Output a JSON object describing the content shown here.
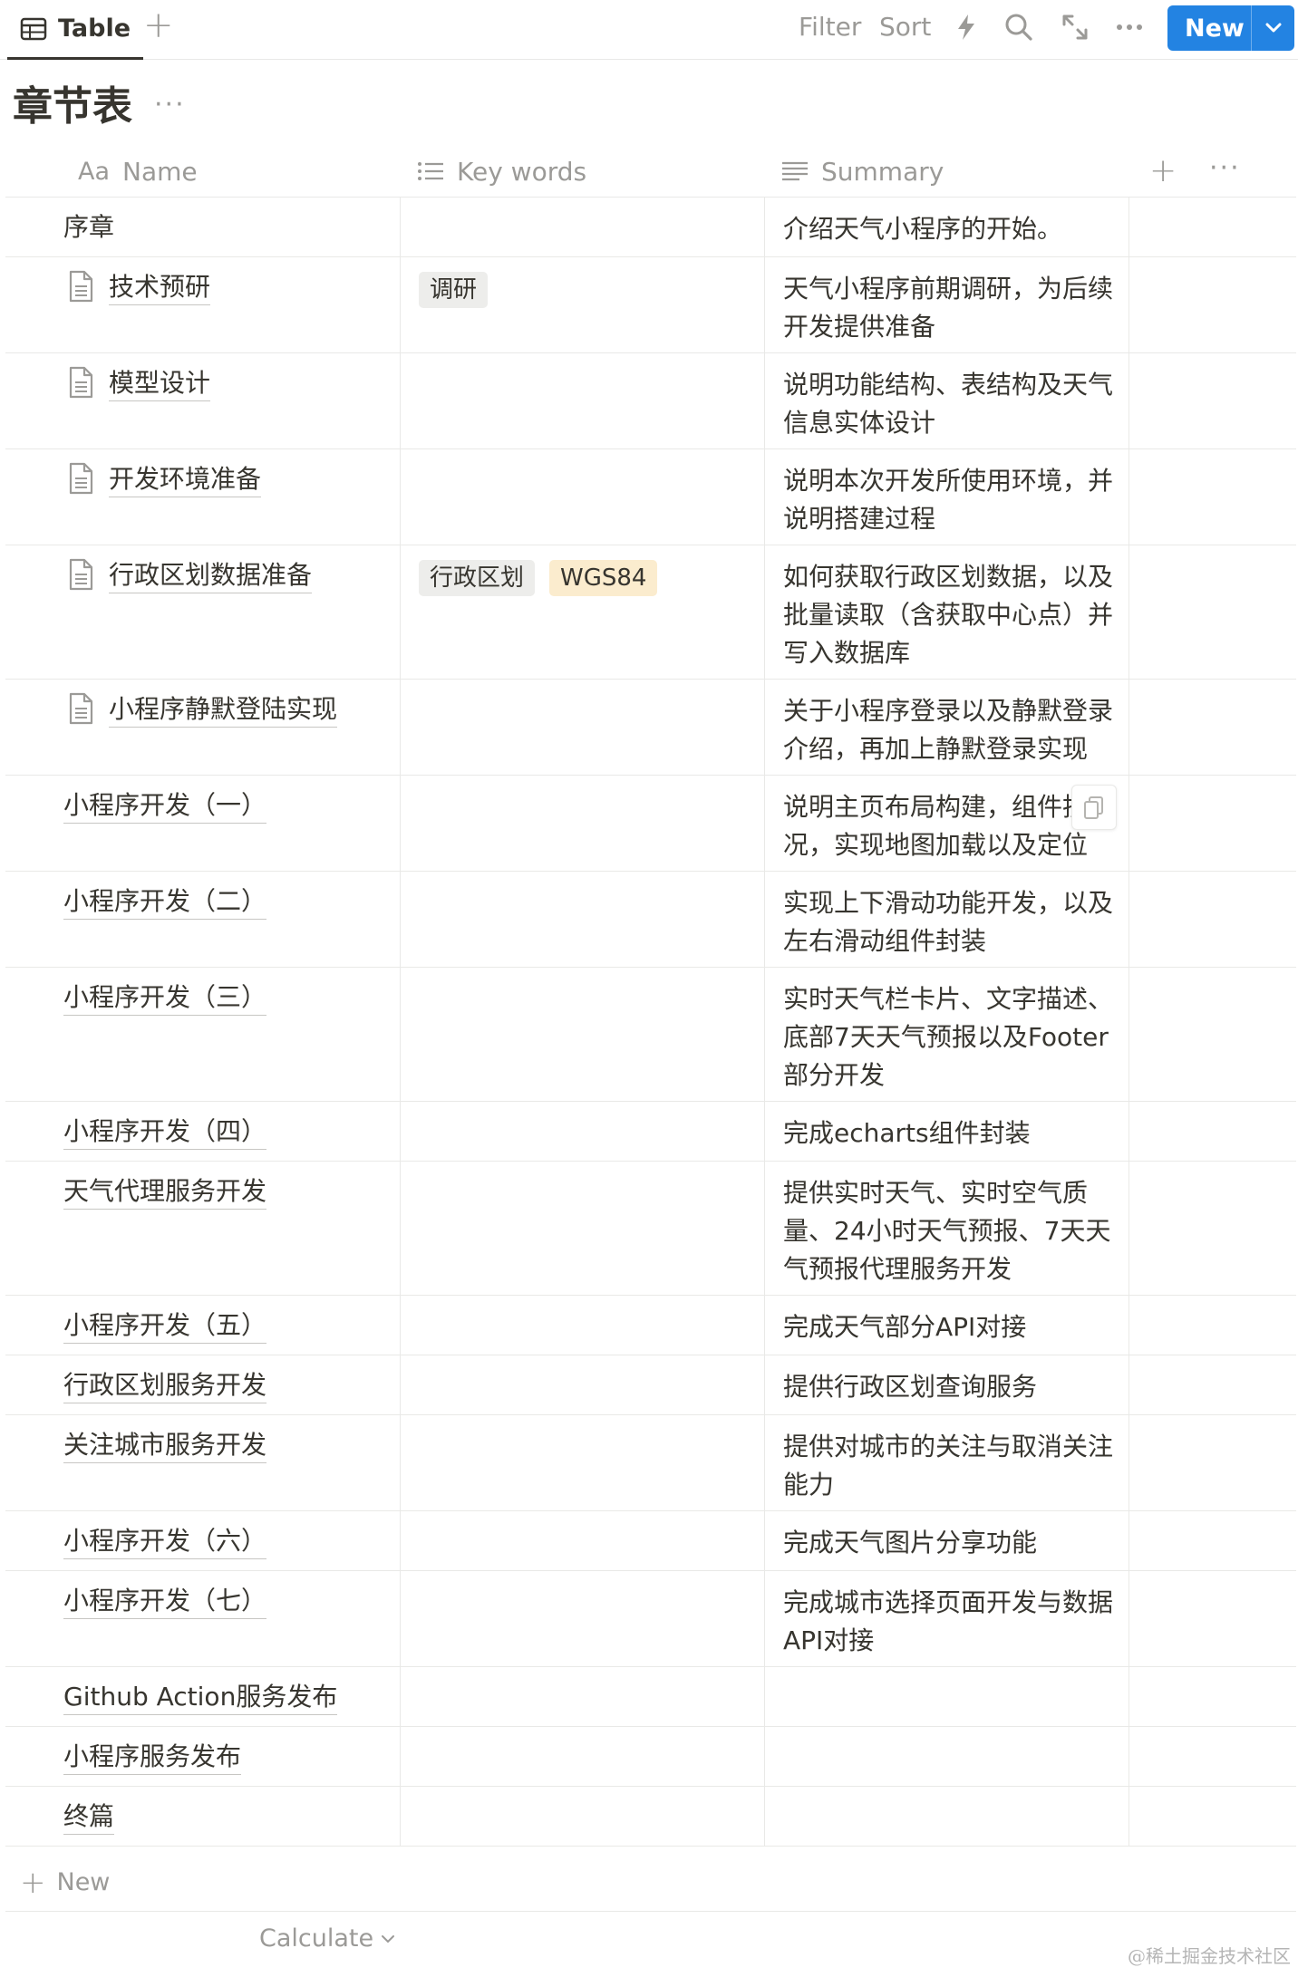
{
  "toolbar": {
    "view_tab": {
      "label": "Table",
      "icon": "table-icon"
    },
    "add_view_label": "+",
    "filter_label": "Filter",
    "sort_label": "Sort",
    "icons": [
      "lightning-icon",
      "search-icon",
      "expand-icon",
      "more-icon"
    ],
    "more_label": "···",
    "new_button_label": "New",
    "accent": "#2383e2"
  },
  "page": {
    "title": "章节表",
    "more_label": "···"
  },
  "table": {
    "columns": [
      {
        "label": "Name",
        "icon_text": "Aa"
      },
      {
        "label": "Key words",
        "icon": "list-icon"
      },
      {
        "label": "Summary",
        "icon": "text-lines-icon"
      }
    ],
    "add_column_label": "+",
    "more_label": "···",
    "rows": [
      {
        "name": "序章",
        "has_page": false,
        "underline": false,
        "tags": [],
        "summary": "介绍天气小程序的开始。"
      },
      {
        "name": "技术预研",
        "has_page": true,
        "underline": true,
        "tags": [
          {
            "text": "调研",
            "color": "#ededeb"
          }
        ],
        "summary": "天气小程序前期调研，为后续开发提供准备"
      },
      {
        "name": "模型设计",
        "has_page": true,
        "underline": true,
        "tags": [],
        "summary": "说明功能结构、表结构及天气信息实体设计"
      },
      {
        "name": "开发环境准备",
        "has_page": true,
        "underline": true,
        "tags": [],
        "summary": "说明本次开发所使用环境，并说明搭建过程"
      },
      {
        "name": "行政区划数据准备",
        "has_page": true,
        "underline": true,
        "tags": [
          {
            "text": "行政区划",
            "color": "#ededeb"
          },
          {
            "text": "WGS84",
            "color": "#fbecce"
          }
        ],
        "summary": "如何获取行政区划数据，以及批量读取（含获取中心点）并写入数据库"
      },
      {
        "name": "小程序静默登陆实现",
        "has_page": true,
        "underline": true,
        "tags": [],
        "summary": "关于小程序登录以及静默登录介绍，再加上静默登录实现"
      },
      {
        "name": "小程序开发（一）",
        "has_page": false,
        "underline": true,
        "tags": [],
        "summary": "说明主页布局构建，组件拆情况，实现地图加载以及定位"
      },
      {
        "name": "小程序开发（二）",
        "has_page": false,
        "underline": true,
        "tags": [],
        "summary": "实现上下滑动功能开发，以及左右滑动组件封装"
      },
      {
        "name": "小程序开发（三）",
        "has_page": false,
        "underline": true,
        "tags": [],
        "summary": "实时天气栏卡片、文字描述、底部7天天气预报以及Footer部分开发"
      },
      {
        "name": "小程序开发（四）",
        "has_page": false,
        "underline": true,
        "tags": [],
        "summary": "完成echarts组件封装"
      },
      {
        "name": "天气代理服务开发",
        "has_page": false,
        "underline": true,
        "tags": [],
        "summary": "提供实时天气、实时空气质量、24小时天气预报、7天天气预报代理服务开发"
      },
      {
        "name": "小程序开发（五）",
        "has_page": false,
        "underline": true,
        "tags": [],
        "summary": "完成天气部分API对接"
      },
      {
        "name": "行政区划服务开发",
        "has_page": false,
        "underline": true,
        "tags": [],
        "summary": "提供行政区划查询服务"
      },
      {
        "name": "关注城市服务开发",
        "has_page": false,
        "underline": true,
        "tags": [],
        "summary": "提供对城市的关注与取消关注能力"
      },
      {
        "name": "小程序开发（六）",
        "has_page": false,
        "underline": true,
        "tags": [],
        "summary": "完成天气图片分享功能"
      },
      {
        "name": "小程序开发（七）",
        "has_page": false,
        "underline": true,
        "tags": [],
        "summary": "完成城市选择页面开发与数据API对接"
      },
      {
        "name": "Github Action服务发布",
        "has_page": false,
        "underline": true,
        "tags": [],
        "summary": ""
      },
      {
        "name": "小程序服务发布",
        "has_page": false,
        "underline": true,
        "tags": [],
        "summary": ""
      },
      {
        "name": "终篇",
        "has_page": false,
        "underline": true,
        "tags": [],
        "summary": ""
      }
    ],
    "new_row_label": "New",
    "calculate_label": "Calculate"
  },
  "watermark": "@稀土掘金技术社区"
}
